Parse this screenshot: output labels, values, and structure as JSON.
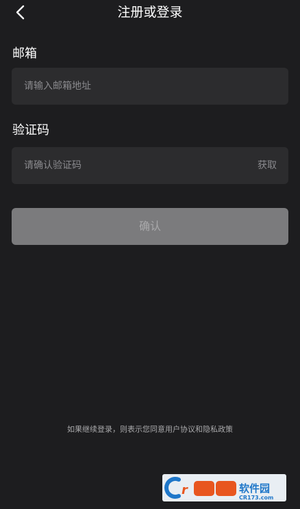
{
  "header": {
    "title": "注册或登录",
    "back_icon": "chevron-left-icon"
  },
  "email": {
    "label": "邮箱",
    "placeholder": "请输入邮箱地址",
    "value": ""
  },
  "code": {
    "label": "验证码",
    "placeholder": "请确认验证码",
    "value": "",
    "get_label": "获取"
  },
  "confirm": {
    "label": "确认"
  },
  "agreement": {
    "text": "如果继续登录，则表示您同意用户协议和隐私政策"
  },
  "watermark": {
    "text": "西西软件园",
    "url": "CR173.com"
  },
  "colors": {
    "background": "#1d1d1f",
    "input_bg": "#2c2c2e",
    "button_disabled": "#7b7b7d",
    "placeholder": "#8a8a8e"
  }
}
